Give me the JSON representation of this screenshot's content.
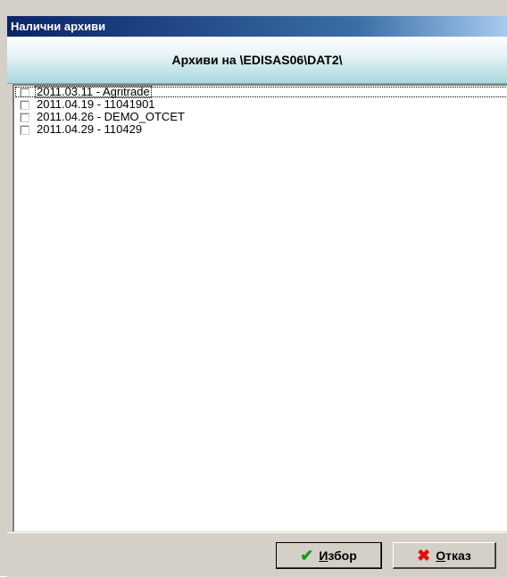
{
  "window": {
    "title": "Налични архиви"
  },
  "header": {
    "text": "Архиви на \\EDISAS06\\DAT2\\"
  },
  "list": {
    "items": [
      {
        "label": "2011.03.11 - Agritrade",
        "checked": false
      },
      {
        "label": "2011.04.19 - 11041901",
        "checked": false
      },
      {
        "label": "2011.04.26 - DEMO_OTCET",
        "checked": false
      },
      {
        "label": "2011.04.29 - 110429",
        "checked": false
      }
    ]
  },
  "buttons": {
    "ok": {
      "label": "Избор",
      "icon": "checkmark-icon",
      "color": "#1a9a1a"
    },
    "cancel": {
      "label": "Отказ",
      "icon": "x-icon",
      "color": "#e01010"
    }
  }
}
